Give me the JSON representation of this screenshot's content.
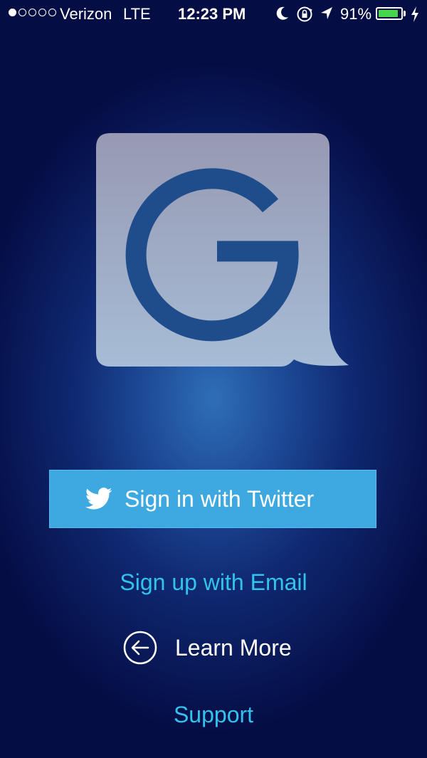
{
  "status_bar": {
    "signal_dots_filled": 1,
    "signal_dots_total": 5,
    "carrier": "Verizon",
    "network": "LTE",
    "time": "12:23 PM",
    "battery_percent": "91%",
    "icons": [
      "moon-icon",
      "rotation-lock-icon",
      "location-arrow-icon",
      "battery-icon",
      "charging-bolt-icon"
    ]
  },
  "logo": {
    "letter_icon": "g-logo-speech-bubble-icon"
  },
  "actions": {
    "twitter_label": "Sign in with Twitter",
    "email_label": "Sign up with Email",
    "learn_more_label": "Learn More",
    "support_label": "Support"
  },
  "colors": {
    "twitter_button": "#3ea9e0",
    "link": "#32c2ec",
    "battery": "#46d64c",
    "background_dark": "#050d45",
    "background_glow": "#2f6eb7"
  }
}
